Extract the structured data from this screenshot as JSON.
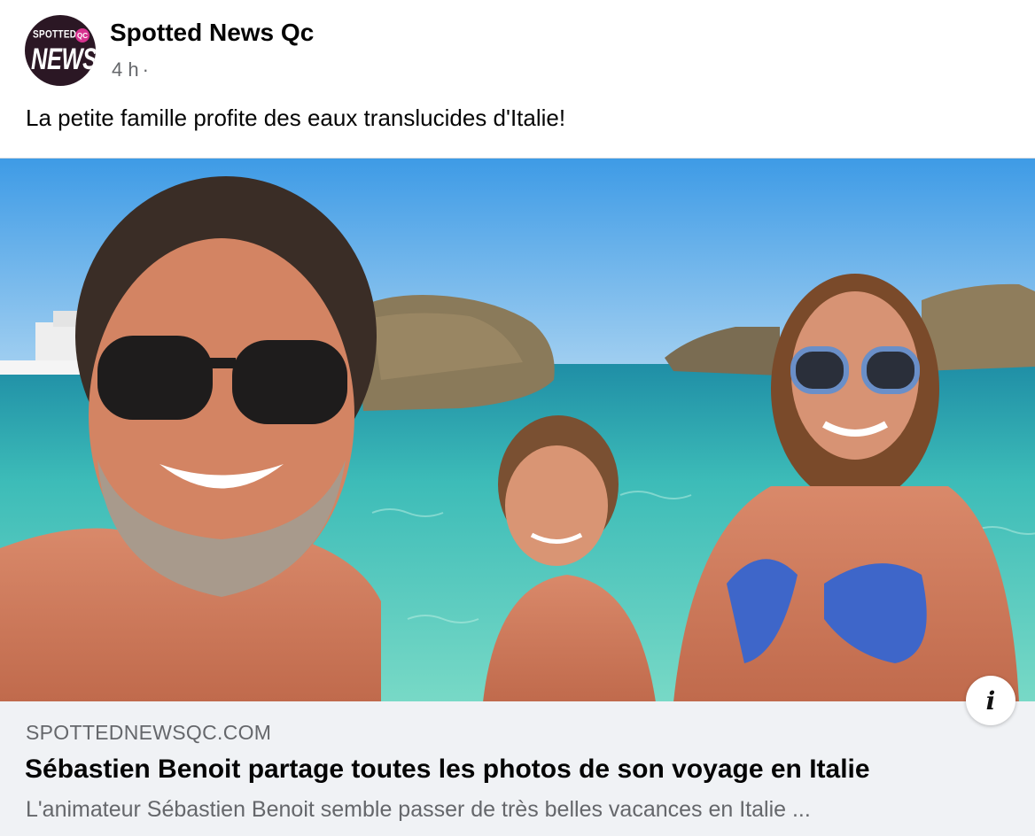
{
  "post": {
    "page_name": "Spotted News Qc",
    "timestamp": "4 h",
    "separator": "·",
    "caption": "La petite famille profite des eaux translucides d'Italie!"
  },
  "avatar": {
    "logo_top_text": "SPOTTED",
    "logo_badge_text": "QC",
    "logo_main_text": "NEWS"
  },
  "photo": {
    "icon": "info-icon",
    "info_glyph": "i"
  },
  "link_preview": {
    "domain": "SPOTTEDNEWSQC.COM",
    "headline": "Sébastien Benoit partage toutes les photos de son voyage en Italie",
    "description": "L'animateur Sébastien Benoit semble passer de très belles vacances en Italie ..."
  },
  "colors": {
    "secondary_text": "#65676b",
    "link_box_bg": "#f0f2f5",
    "avatar_bg": "#2b1724",
    "avatar_badge": "#d6338f"
  }
}
